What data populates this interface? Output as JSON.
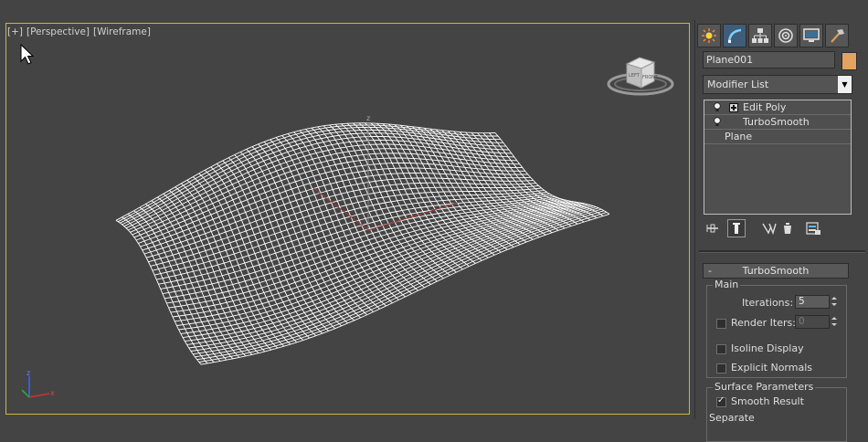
{
  "viewport": {
    "labels": [
      "[+]",
      "[Perspective]",
      "[Wireframe]"
    ],
    "axis_z_label": "z",
    "viewcube_labels": [
      "FRONT",
      "LEFT"
    ],
    "tripod_labels": [
      "z",
      "x"
    ],
    "active_border_color": "#c9b83a",
    "mesh_color": "#ffffff"
  },
  "panel": {
    "tabs": [
      "create-icon",
      "modify-icon",
      "hierarchy-icon",
      "motion-icon",
      "display-icon",
      "utilities-icon"
    ],
    "active_tab": "modify-icon",
    "object_name": "Plane001",
    "object_color": "#e3a25f",
    "modifier_list_label": "Modifier List",
    "stack": [
      {
        "label": "Edit Poly",
        "has_bulb": true,
        "has_plus": true
      },
      {
        "label": "TurboSmooth",
        "has_bulb": true,
        "has_plus": false
      },
      {
        "label": "Plane",
        "has_bulb": false,
        "has_plus": false
      }
    ],
    "stack_tools": [
      "pin-stack-icon",
      "show-end-result-icon",
      "make-unique-icon",
      "remove-modifier-icon",
      "configure-sets-icon"
    ]
  },
  "turbosmooth": {
    "title": "TurboSmooth",
    "collapse_symbol": "-",
    "main_group": "Main",
    "iterations_label": "Iterations:",
    "iterations_value": "5",
    "render_iters_label": "Render Iters:",
    "render_iters_value": "0",
    "render_iters_checked": false,
    "isoline_label": "Isoline Display",
    "isoline_checked": false,
    "explicit_normals_label": "Explicit Normals",
    "explicit_normals_checked": false,
    "surface_group": "Surface Parameters",
    "smooth_result_label": "Smooth Result",
    "smooth_result_checked": true,
    "separate_label": "Separate"
  }
}
